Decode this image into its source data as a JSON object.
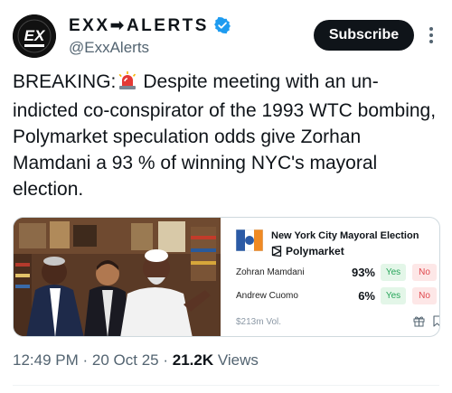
{
  "account": {
    "avatar_text": "EX",
    "display_name": "EXX➡ALERTS",
    "handle": "@ExxAlerts",
    "verified": true
  },
  "actions": {
    "subscribe_label": "Subscribe",
    "more_icon": "more-vertical-icon"
  },
  "tweet": {
    "prefix": "BREAKING:",
    "emoji": "siren-icon",
    "body": "Despite meeting with an un-indicted co-conspirator of the 1993 WTC bombing, Polymarket speculation odds give Zorhan Mamdani a 93 % of winning NYC's mayoral election."
  },
  "card": {
    "title": "New York City Mayoral Election",
    "brand": "Polymarket",
    "rows": [
      {
        "candidate": "Zohran Mamdani",
        "pct": "93%",
        "yes": "Yes",
        "no": "No"
      },
      {
        "candidate": "Andrew Cuomo",
        "pct": "6%",
        "yes": "Yes",
        "no": "No"
      }
    ],
    "volume": "$213m Vol.",
    "icons": [
      "gift-icon",
      "bookmark-icon"
    ]
  },
  "meta": {
    "time": "12:49 PM",
    "sep1": "·",
    "date": "20 Oct 25",
    "sep2": "·",
    "views": "21.2K",
    "views_label": "Views"
  },
  "colors": {
    "accent_black": "#0f1419",
    "secondary": "#536471",
    "verified_blue": "#1d9bf0",
    "yes_green": "#27a55a",
    "no_red": "#e0484e"
  }
}
